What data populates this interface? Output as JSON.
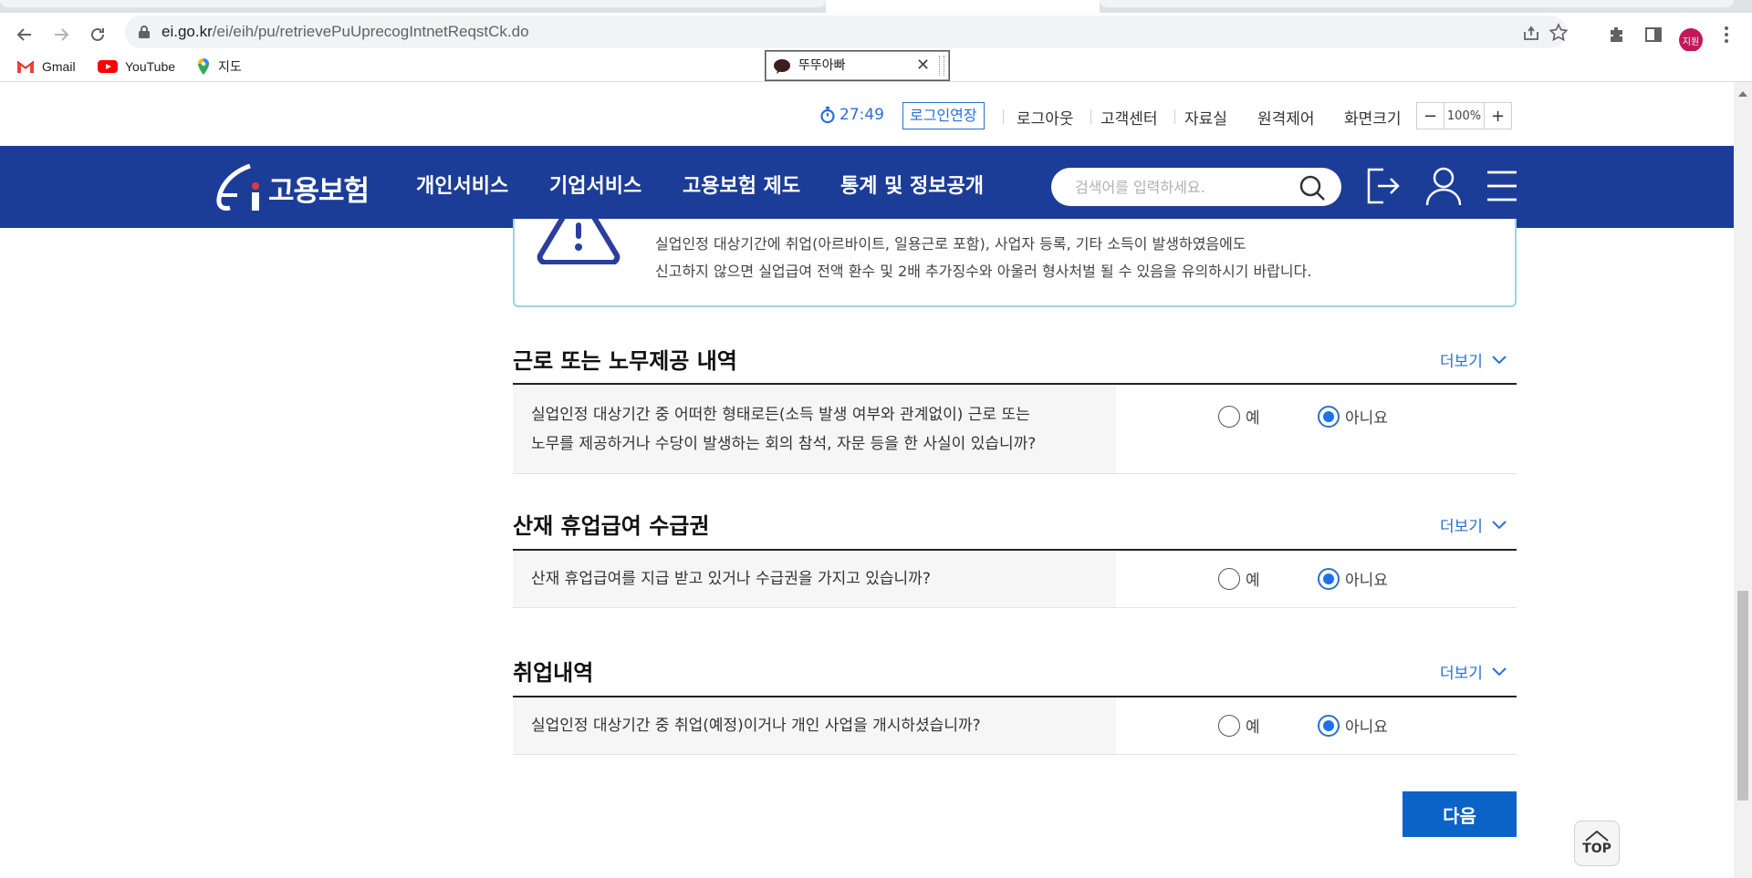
{
  "browser": {
    "url_host": "ei.go.kr",
    "url_path": "/ei/eih/pu/retrievePuUprecogIntnetReqstCk.do",
    "profile_label": "지원",
    "bookmarks": [
      {
        "label": "Gmail"
      },
      {
        "label": "YouTube"
      },
      {
        "label": "지도"
      }
    ]
  },
  "floating_window": {
    "title": "뚜뚜아빠",
    "close": "✕"
  },
  "utility": {
    "timer": "27:49",
    "extend_login": "로그인연장",
    "links": [
      "로그아웃",
      "고객센터",
      "자료실",
      "원격제어",
      "화면크기"
    ],
    "zoom_minus": "−",
    "zoom_value": "100%",
    "zoom_plus": "+"
  },
  "header": {
    "logo_text": "고용보험",
    "nav": [
      "개인서비스",
      "기업서비스",
      "고용보험 제도",
      "통계 및 정보공개"
    ],
    "search_placeholder": "검색어를 입력하세요."
  },
  "notice": {
    "line1": "실업인정 대상기간에 취업(아르바이트, 일용근로 포함), 사업자 등록, 기타 소득이 발생하였음에도",
    "line2": "신고하지 않으면 실업급여 전액 환수 및 2배 추가징수와 아울러 형사처벌 될 수 있음을 유의하시기 바랍니다."
  },
  "sections": [
    {
      "title": "근로 또는 노무제공 내역",
      "more": "더보기",
      "question_line1": "실업인정 대상기간 중 어떠한 형태로든(소득 발생 여부와 관계없이) 근로 또는",
      "question_line2": "노무를 제공하거나 수당이 발생하는 회의 참석, 자문 등을 한 사실이 있습니까?",
      "yes": "예",
      "no": "아니요",
      "selected": "no"
    },
    {
      "title": "산재 휴업급여 수급권",
      "more": "더보기",
      "question_line1": "산재 휴업급여를 지급 받고 있거나 수급권을 가지고 있습니까?",
      "yes": "예",
      "no": "아니요",
      "selected": "no"
    },
    {
      "title": "취업내역",
      "more": "더보기",
      "question_line1": "실업인정 대상기간 중 취업(예정)이거나 개인 사업을 개시하셨습니까?",
      "yes": "예",
      "no": "아니요",
      "selected": "no"
    }
  ],
  "buttons": {
    "next": "다음",
    "top": "TOP"
  },
  "colors": {
    "header_bg": "#1c3d97",
    "accent": "#2a6fd4",
    "next_bg": "#0b63c8"
  }
}
